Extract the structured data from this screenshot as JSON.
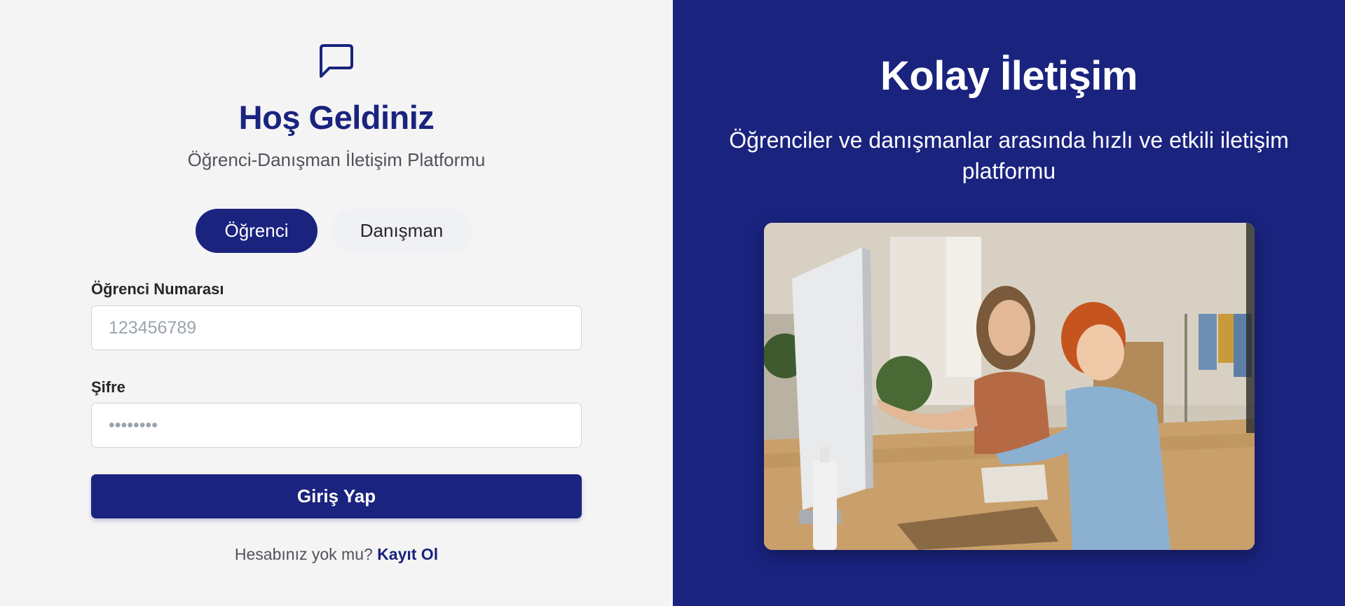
{
  "login": {
    "title": "Hoş Geldiniz",
    "subtitle": "Öğrenci-Danışman İletişim Platformu",
    "roles": {
      "student": "Öğrenci",
      "advisor": "Danışman",
      "selected": "Öğrenci"
    },
    "fields": {
      "student_number_label": "Öğrenci Numarası",
      "student_number_placeholder": "123456789",
      "password_label": "Şifre",
      "password_placeholder": "••••••••"
    },
    "submit_label": "Giriş Yap",
    "signup_prompt": "Hesabınız yok mu?",
    "signup_link": "Kayıt Ol"
  },
  "hero": {
    "title": "Kolay İletişim",
    "subtitle": "Öğrenciler ve danışmanlar arasında hızlı ve etkili iletişim platformu"
  },
  "colors": {
    "brand": "#1a237e",
    "background": "#f4f4f5"
  },
  "icons": {
    "logo": "chat-bubble-icon"
  }
}
